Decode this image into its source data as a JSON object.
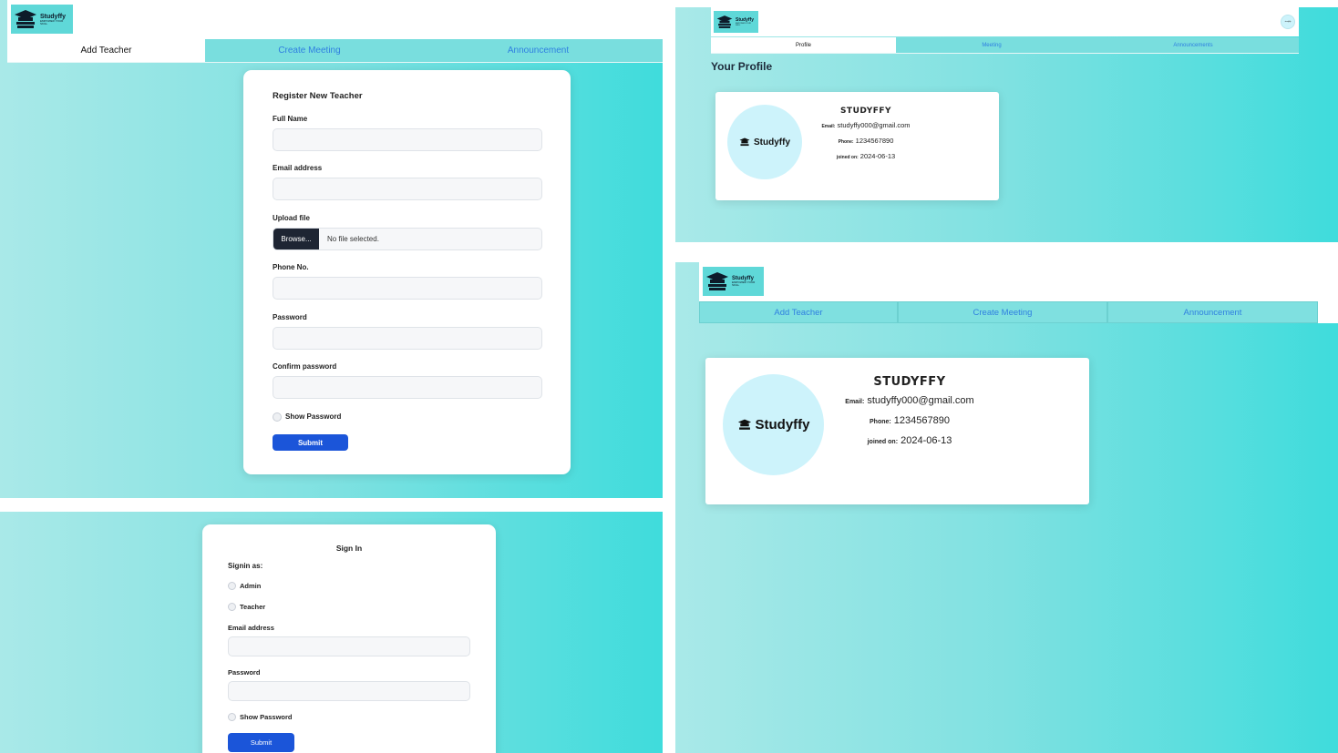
{
  "logo": {
    "brand": "Studyffy",
    "tagline": "EMPOWER YOUR SKILL"
  },
  "admin_tabs": [
    "Add Teacher",
    "Create Meeting",
    "Announcement"
  ],
  "register_form": {
    "title": "Register New Teacher",
    "full_name_label": "Full Name",
    "email_label": "Email address",
    "upload_label": "Upload file",
    "browse_label": "Browse...",
    "no_file_text": "No file selected.",
    "phone_label": "Phone No.",
    "password_label": "Password",
    "confirm_password_label": "Confirm password",
    "show_password_label": "Show Password",
    "submit_label": "Submit"
  },
  "signin_form": {
    "title": "Sign In",
    "signin_as_label": "Signin as:",
    "role_admin": "Admin",
    "role_teacher": "Teacher",
    "email_label": "Email address",
    "password_label": "Password",
    "show_password_label": "Show Password",
    "submit_label": "Submit"
  },
  "teacher_tabs": [
    "Profile",
    "Meeting",
    "Announcements"
  ],
  "profile_page": {
    "heading": "Your Profile",
    "user_badge": "studyffy"
  },
  "profile": {
    "name": "STUDYFFY",
    "email_label": "Email:",
    "email": "studyffy000@gmail.com",
    "phone_label": "Phone:",
    "phone": "1234567890",
    "joined_label": "joined on:",
    "joined": "2024-06-13",
    "avatar_text": "Studyffy"
  },
  "colors": {
    "gradient_start": "#a9e9e8",
    "gradient_end": "#3fdcdc",
    "primary_button": "#1b55d9",
    "link": "#2f7fe0",
    "browse_button": "#1e2533"
  }
}
